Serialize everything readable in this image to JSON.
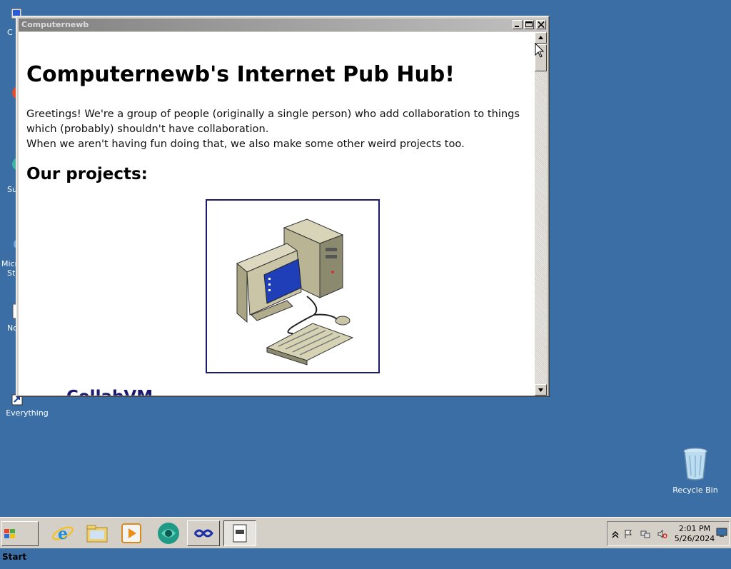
{
  "window": {
    "title": "Computernewb",
    "buttons": {
      "minimize": "_",
      "maximize": "□",
      "close": "×"
    }
  },
  "page": {
    "heading": "Computernewb's Internet Pub Hub!",
    "intro_line1": "Greetings! We're a group of people (originally a single person) who add collaboration to things which (probably) shouldn't have collaboration.",
    "intro_line2": "When we aren't having fun doing that, we also make some other weird projects too.",
    "projects_heading": "Our projects:",
    "project_link": "CollabVM"
  },
  "desktop": {
    "icons": [
      {
        "label": "Everything",
        "icon": "shortcut-icon"
      },
      {
        "label": "Recycle Bin",
        "icon": "recycle-bin-icon"
      }
    ],
    "partial_labels": [
      "C",
      "Su",
      "Micro",
      "Stu",
      "No"
    ]
  },
  "taskbar": {
    "start_label": "Start",
    "quick_launch": [
      "internet-explorer-icon",
      "explorer-icon",
      "media-player-icon",
      "browser-icon"
    ],
    "tasks": [
      "collabvm-task-icon",
      "document-task-icon"
    ],
    "tray": {
      "time": "2:01 PM",
      "date": "5/26/2024"
    }
  },
  "colors": {
    "desktop": "#3a6ea5",
    "link": "#1a1a6e",
    "chrome": "#d4d0c8"
  }
}
